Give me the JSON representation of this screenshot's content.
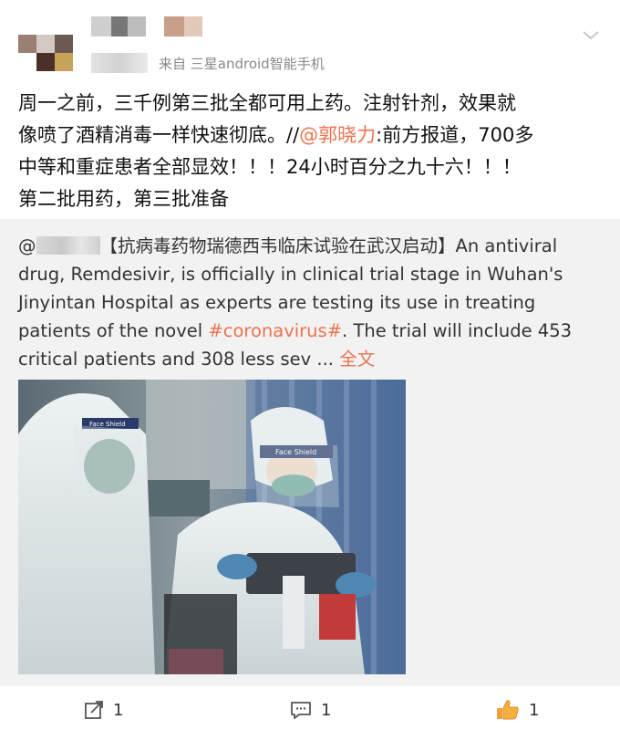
{
  "header": {
    "source_label": "来自 三星android智能手机",
    "collapse_icon": "chevron-down-icon"
  },
  "post": {
    "lines": [
      {
        "text": "周一之前，三千例第三批全都可用上药。注射针剂，效果就"
      },
      {
        "prefix": "像喷了酒精消毒一样快速彻底。//",
        "mention": "@郭晓力",
        "suffix": ":前方报道，700多"
      },
      {
        "text": "中等和重症患者全部显效！！！24小时百分之九十六！！！"
      },
      {
        "text": "第二批用药，第三批准备"
      }
    ]
  },
  "repost": {
    "line1_prefix": "@",
    "line1_rest": "【抗病毒药物瑞德西韦临床试验在武汉启动】An antiviral",
    "line2": "drug, Remdesivir, is officially in clinical trial stage in Wuhan's",
    "line3": "Jinyintan Hospital as experts are testing its use in treating",
    "line4_prefix": "patients of the novel ",
    "hashtag": "#coronavirus#",
    "line4_suffix": ". The trial will include 453",
    "line5": "critical patients and 308 less sev ... ",
    "full_text_link": "全文",
    "photo": {
      "shield_label_1": "Face Shield",
      "shield_label_2": "Face Shield"
    }
  },
  "actions": {
    "repost_count": "1",
    "comment_count": "1",
    "like_count": "1"
  },
  "colors": {
    "link": "#eb7350",
    "repost_bg": "#f2f2f2",
    "meta_text": "#8a8a8a"
  }
}
